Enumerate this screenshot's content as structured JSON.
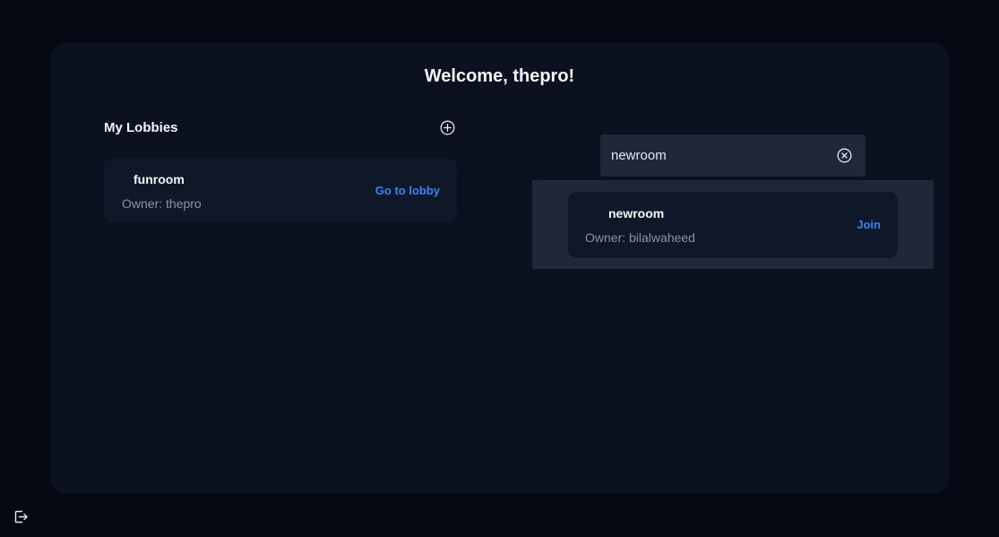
{
  "header": {
    "welcome": "Welcome, thepro!"
  },
  "my_lobbies": {
    "title": "My Lobbies",
    "add_icon": "plus-circle-icon",
    "items": [
      {
        "name": "funroom",
        "owner": "Owner: thepro",
        "action": "Go to lobby"
      }
    ]
  },
  "search": {
    "value": "newroom",
    "clear_icon": "close-circle-icon",
    "results": [
      {
        "name": "newroom",
        "owner": "Owner: bilalwaheed",
        "action": "Join"
      }
    ]
  },
  "footer": {
    "logout_icon": "logout-icon"
  },
  "colors": {
    "background": "#050914",
    "panel": "#0b111e",
    "card": "#0f1829",
    "search_area": "#1e2838",
    "accent": "#3b82f6",
    "muted_text": "#8b93a3"
  }
}
